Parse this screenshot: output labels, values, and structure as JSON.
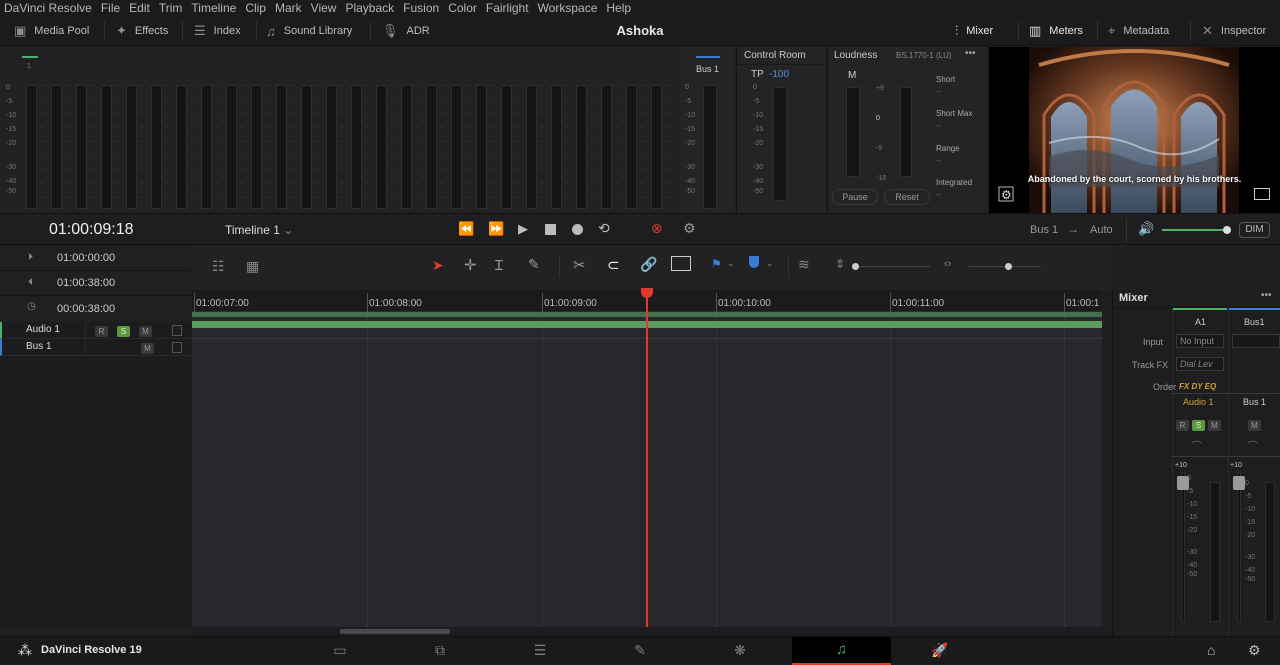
{
  "menu": [
    "DaVinci Resolve",
    "File",
    "Edit",
    "Trim",
    "Timeline",
    "Clip",
    "Mark",
    "View",
    "Playback",
    "Fusion",
    "Color",
    "Fairlight",
    "Workspace",
    "Help"
  ],
  "toolbar": {
    "media_pool": "Media Pool",
    "effects": "Effects",
    "index": "Index",
    "sound_library": "Sound Library",
    "adr": "ADR",
    "project_title": "Ashoka",
    "mixer": "Mixer",
    "meters": "Meters",
    "metadata": "Metadata",
    "inspector": "Inspector"
  },
  "meters": {
    "channel_number": "1",
    "scale": [
      "0",
      "-5",
      "-10",
      "-15",
      "-20",
      "-30",
      "-40",
      "-50"
    ],
    "bus_label": "Bus 1"
  },
  "control_room": {
    "title": "Control Room",
    "tp_label": "TP",
    "tp_value": "-100"
  },
  "loudness": {
    "title": "Loudness",
    "standard": "BS.1770-1 (LU)",
    "more": "•••",
    "m_label": "M",
    "scale": [
      "+9",
      "0",
      "-9",
      "-18"
    ],
    "short": "Short",
    "short_max": "Short Max",
    "range": "Range",
    "integrated": "Integrated",
    "dash": "--",
    "pause": "Pause",
    "reset": "Reset"
  },
  "viewer": {
    "subtitle": "Abandoned by the court, scorned by his brothers."
  },
  "transport": {
    "timecode": "01:00:09:18",
    "timeline_name": "Timeline 1",
    "bus_route": "Bus 1",
    "arrow": "→",
    "auto": "Auto",
    "dim": "DIM",
    "volume_level": 0.95
  },
  "timecodes": {
    "in": "01:00:00:00",
    "out": "01:00:38:00",
    "duration": "00:00:38:00"
  },
  "tracks": [
    {
      "name": "Audio 1",
      "r": "R",
      "s": "S",
      "m": "M"
    },
    {
      "name": "Bus 1",
      "m": "M"
    }
  ],
  "ruler": [
    "01:00:07:00",
    "01:00:08:00",
    "01:00:09:00",
    "01:00:10:00",
    "01:00:11:00",
    "01:00:1"
  ],
  "playhead_fraction": 0.5,
  "mixer": {
    "title": "Mixer",
    "more": "•••",
    "col_a1": "A1",
    "col_bus1": "Bus1",
    "input_label": "Input",
    "input_value": "No Input",
    "trackfx_label": "Track FX",
    "trackfx_value": "Dial Lev",
    "order_label": "Order",
    "order_value": "FX DY EQ",
    "ch_audio1": "Audio 1",
    "ch_bus1": "Bus 1",
    "r": "R",
    "s": "S",
    "m": "M",
    "fader_scale": [
      "+10",
      "0",
      "-5",
      "-10",
      "-15",
      "-20",
      "-30",
      "-40",
      "-50"
    ]
  },
  "bottom": {
    "app_name": "DaVinci Resolve 19"
  },
  "colors": {
    "accent_green": "#4fb06a",
    "playhead": "#e0392e",
    "blue": "#3b7bd8",
    "clip_green": "#5a9e5f"
  }
}
